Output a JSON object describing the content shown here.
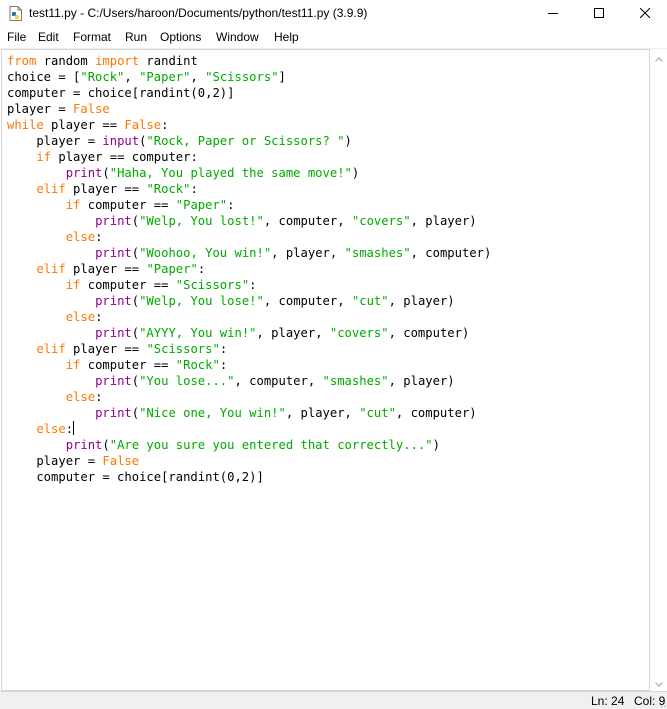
{
  "window": {
    "title": "test11.py - C:/Users/haroon/Documents/python/test11.py (3.9.9)"
  },
  "icons": {
    "app": "python-file-icon",
    "minimize": "minimize-icon",
    "maximize": "maximize-icon",
    "close": "close-icon",
    "scroll_up": "chevron-up-icon",
    "scroll_down": "chevron-down-icon"
  },
  "menu": {
    "file": "File",
    "edit": "Edit",
    "format": "Format",
    "run": "Run",
    "options": "Options",
    "window": "Window",
    "help": "Help"
  },
  "colors": {
    "keyword": "#ff7700",
    "string": "#00aa00",
    "builtin": "#900090",
    "text": "#000000"
  },
  "editor": {
    "lines": [
      [
        {
          "t": "kw",
          "v": "from"
        },
        {
          "t": "p",
          "v": " random "
        },
        {
          "t": "kw",
          "v": "import"
        },
        {
          "t": "p",
          "v": " randint"
        }
      ],
      [
        {
          "t": "p",
          "v": "choice = ["
        },
        {
          "t": "str",
          "v": "\"Rock\""
        },
        {
          "t": "p",
          "v": ", "
        },
        {
          "t": "str",
          "v": "\"Paper\""
        },
        {
          "t": "p",
          "v": ", "
        },
        {
          "t": "str",
          "v": "\"Scissors\""
        },
        {
          "t": "p",
          "v": "]"
        }
      ],
      [
        {
          "t": "p",
          "v": "computer = choice[randint(0,2)]"
        }
      ],
      [
        {
          "t": "p",
          "v": "player = "
        },
        {
          "t": "kw",
          "v": "False"
        }
      ],
      [
        {
          "t": "kw",
          "v": "while"
        },
        {
          "t": "p",
          "v": " player == "
        },
        {
          "t": "kw",
          "v": "False"
        },
        {
          "t": "p",
          "v": ":"
        }
      ],
      [
        {
          "t": "p",
          "v": "    player = "
        },
        {
          "t": "bi",
          "v": "input"
        },
        {
          "t": "p",
          "v": "("
        },
        {
          "t": "str",
          "v": "\"Rock, Paper or Scissors? \""
        },
        {
          "t": "p",
          "v": ")"
        }
      ],
      [
        {
          "t": "p",
          "v": "    "
        },
        {
          "t": "kw",
          "v": "if"
        },
        {
          "t": "p",
          "v": " player == computer:"
        }
      ],
      [
        {
          "t": "p",
          "v": "        "
        },
        {
          "t": "bi",
          "v": "print"
        },
        {
          "t": "p",
          "v": "("
        },
        {
          "t": "str",
          "v": "\"Haha, You played the same move!\""
        },
        {
          "t": "p",
          "v": ")"
        }
      ],
      [
        {
          "t": "p",
          "v": "    "
        },
        {
          "t": "kw",
          "v": "elif"
        },
        {
          "t": "p",
          "v": " player == "
        },
        {
          "t": "str",
          "v": "\"Rock\""
        },
        {
          "t": "p",
          "v": ":"
        }
      ],
      [
        {
          "t": "p",
          "v": "        "
        },
        {
          "t": "kw",
          "v": "if"
        },
        {
          "t": "p",
          "v": " computer == "
        },
        {
          "t": "str",
          "v": "\"Paper\""
        },
        {
          "t": "p",
          "v": ":"
        }
      ],
      [
        {
          "t": "p",
          "v": "            "
        },
        {
          "t": "bi",
          "v": "print"
        },
        {
          "t": "p",
          "v": "("
        },
        {
          "t": "str",
          "v": "\"Welp, You lost!\""
        },
        {
          "t": "p",
          "v": ", computer, "
        },
        {
          "t": "str",
          "v": "\"covers\""
        },
        {
          "t": "p",
          "v": ", player)"
        }
      ],
      [
        {
          "t": "p",
          "v": "        "
        },
        {
          "t": "kw",
          "v": "else"
        },
        {
          "t": "p",
          "v": ":"
        }
      ],
      [
        {
          "t": "p",
          "v": "            "
        },
        {
          "t": "bi",
          "v": "print"
        },
        {
          "t": "p",
          "v": "("
        },
        {
          "t": "str",
          "v": "\"Woohoo, You win!\""
        },
        {
          "t": "p",
          "v": ", player, "
        },
        {
          "t": "str",
          "v": "\"smashes\""
        },
        {
          "t": "p",
          "v": ", computer)"
        }
      ],
      [
        {
          "t": "p",
          "v": "    "
        },
        {
          "t": "kw",
          "v": "elif"
        },
        {
          "t": "p",
          "v": " player == "
        },
        {
          "t": "str",
          "v": "\"Paper\""
        },
        {
          "t": "p",
          "v": ":"
        }
      ],
      [
        {
          "t": "p",
          "v": "        "
        },
        {
          "t": "kw",
          "v": "if"
        },
        {
          "t": "p",
          "v": " computer == "
        },
        {
          "t": "str",
          "v": "\"Scissors\""
        },
        {
          "t": "p",
          "v": ":"
        }
      ],
      [
        {
          "t": "p",
          "v": "            "
        },
        {
          "t": "bi",
          "v": "print"
        },
        {
          "t": "p",
          "v": "("
        },
        {
          "t": "str",
          "v": "\"Welp, You lose!\""
        },
        {
          "t": "p",
          "v": ", computer, "
        },
        {
          "t": "str",
          "v": "\"cut\""
        },
        {
          "t": "p",
          "v": ", player)"
        }
      ],
      [
        {
          "t": "p",
          "v": "        "
        },
        {
          "t": "kw",
          "v": "else"
        },
        {
          "t": "p",
          "v": ":"
        }
      ],
      [
        {
          "t": "p",
          "v": "            "
        },
        {
          "t": "bi",
          "v": "print"
        },
        {
          "t": "p",
          "v": "("
        },
        {
          "t": "str",
          "v": "\"AYYY, You win!\""
        },
        {
          "t": "p",
          "v": ", player, "
        },
        {
          "t": "str",
          "v": "\"covers\""
        },
        {
          "t": "p",
          "v": ", computer)"
        }
      ],
      [
        {
          "t": "p",
          "v": "    "
        },
        {
          "t": "kw",
          "v": "elif"
        },
        {
          "t": "p",
          "v": " player == "
        },
        {
          "t": "str",
          "v": "\"Scissors\""
        },
        {
          "t": "p",
          "v": ":"
        }
      ],
      [
        {
          "t": "p",
          "v": "        "
        },
        {
          "t": "kw",
          "v": "if"
        },
        {
          "t": "p",
          "v": " computer == "
        },
        {
          "t": "str",
          "v": "\"Rock\""
        },
        {
          "t": "p",
          "v": ":"
        }
      ],
      [
        {
          "t": "p",
          "v": "            "
        },
        {
          "t": "bi",
          "v": "print"
        },
        {
          "t": "p",
          "v": "("
        },
        {
          "t": "str",
          "v": "\"You lose...\""
        },
        {
          "t": "p",
          "v": ", computer, "
        },
        {
          "t": "str",
          "v": "\"smashes\""
        },
        {
          "t": "p",
          "v": ", player)"
        }
      ],
      [
        {
          "t": "p",
          "v": "        "
        },
        {
          "t": "kw",
          "v": "else"
        },
        {
          "t": "p",
          "v": ":"
        }
      ],
      [
        {
          "t": "p",
          "v": "            "
        },
        {
          "t": "bi",
          "v": "print"
        },
        {
          "t": "p",
          "v": "("
        },
        {
          "t": "str",
          "v": "\"Nice one, You win!\""
        },
        {
          "t": "p",
          "v": ", player, "
        },
        {
          "t": "str",
          "v": "\"cut\""
        },
        {
          "t": "p",
          "v": ", computer)"
        }
      ],
      [
        {
          "t": "p",
          "v": "    "
        },
        {
          "t": "kw",
          "v": "else"
        },
        {
          "t": "p",
          "v": ":"
        },
        {
          "t": "cursor",
          "v": ""
        }
      ],
      [
        {
          "t": "p",
          "v": "        "
        },
        {
          "t": "bi",
          "v": "print"
        },
        {
          "t": "p",
          "v": "("
        },
        {
          "t": "str",
          "v": "\"Are you sure you entered that correctly...\""
        },
        {
          "t": "p",
          "v": ")"
        }
      ],
      [
        {
          "t": "p",
          "v": "    player = "
        },
        {
          "t": "kw",
          "v": "False"
        }
      ],
      [
        {
          "t": "p",
          "v": "    computer = choice[randint(0,2)]"
        }
      ]
    ]
  },
  "status": {
    "line": "Ln: 24",
    "col": "Col: 9"
  }
}
